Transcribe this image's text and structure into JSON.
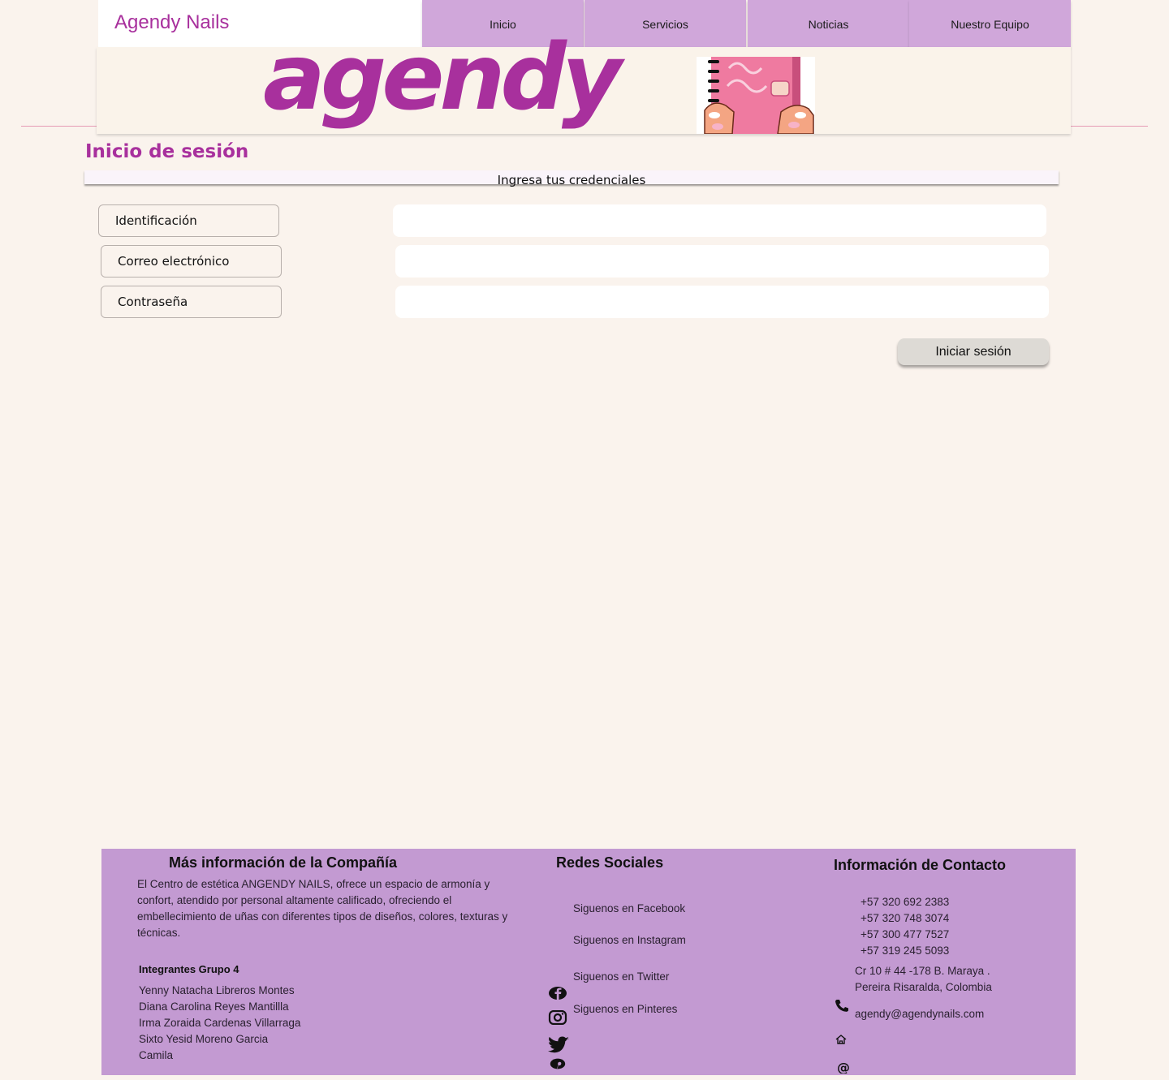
{
  "header": {
    "brand": "Agendy Nails",
    "nav": [
      {
        "label": "Inicio"
      },
      {
        "label": "Servicios"
      },
      {
        "label": "Noticias"
      },
      {
        "label": "Nuestro Equipo"
      }
    ],
    "banner_logo_text": "agendy"
  },
  "login": {
    "title": "Inicio de sesión",
    "subtitle": "Ingresa tus credenciales",
    "fields": [
      {
        "label": "Identificación",
        "value": "",
        "placeholder": ""
      },
      {
        "label": "Correo electrónico",
        "value": "",
        "placeholder": ""
      },
      {
        "label": "Contraseña",
        "value": "",
        "placeholder": ""
      }
    ],
    "submit_label": "Iniciar sesión"
  },
  "footer": {
    "company": {
      "title": "Más información de la Compañía",
      "description": "El Centro de estética ANGENDY NAILS, ofrece un espacio de armonía y confort, atendido por personal altamente calificado, ofreciendo el embellecimiento de uñas con diferentes tipos de diseños, colores, texturas y técnicas.",
      "team_title": "Integrantes Grupo 4",
      "team": [
        "Yenny Natacha Libreros Montes",
        "Diana Carolina Reyes Mantillla",
        "Irma Zoraida Cardenas Villarraga",
        "Sixto Yesid Moreno Garcia",
        "Camila"
      ]
    },
    "social": {
      "title": "Redes Sociales",
      "links": [
        {
          "label": "Siguenos en Facebook",
          "icon": "facebook-icon"
        },
        {
          "label": "Siguenos en Instagram",
          "icon": "instagram-icon"
        },
        {
          "label": "Siguenos en Twitter",
          "icon": "twitter-icon"
        },
        {
          "label": "Siguenos en Pinteres",
          "icon": "pinterest-icon"
        }
      ]
    },
    "contact": {
      "title": "Información de Contacto",
      "phones": [
        "+57 320 692 2383",
        "+57 320 748 3074",
        "+57 300 477 7527",
        "+57 319 245 5093"
      ],
      "address_line1": "Cr 10 # 44 -178 B. Maraya .",
      "address_line2": "Pereira Risaralda, Colombia",
      "email": "agendy@agendynails.com"
    }
  },
  "colors": {
    "brand": "#a8309d",
    "nav_bg": "#d0a7da",
    "footer_bg": "#c39ad2",
    "page_bg": "#faf3ed"
  }
}
